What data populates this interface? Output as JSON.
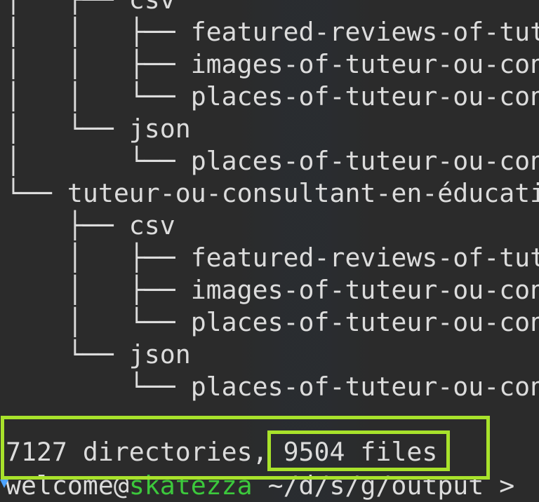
{
  "terminal": {
    "tree_lines": [
      "│   ├── csv",
      "│   │   ├── featured-reviews-of-tut",
      "│   │   ├── images-of-tuteur-ou-con",
      "│   │   └── places-of-tuteur-ou-con",
      "│   └── json",
      "│       └── places-of-tuteur-ou-con",
      "└── tuteur-ou-consultant-en-éducati",
      "    ├── csv",
      "    │   ├── featured-reviews-of-tut",
      "    │   ├── images-of-tuteur-ou-con",
      "    │   └── places-of-tuteur-ou-con",
      "    └── json",
      "        └── places-of-tuteur-ou-con"
    ],
    "summary": {
      "directories": "7127 directories,",
      "files": "9504 files"
    },
    "prompt": {
      "user": "welcome",
      "at": "@",
      "host": "skatezza",
      "path": " ~/d/s/g/output",
      "symbol": " >"
    }
  },
  "colors": {
    "background": "#2b2b2b",
    "text": "#dcdcdc",
    "host": "#3cc83c",
    "highlight": "#a8e22b"
  }
}
